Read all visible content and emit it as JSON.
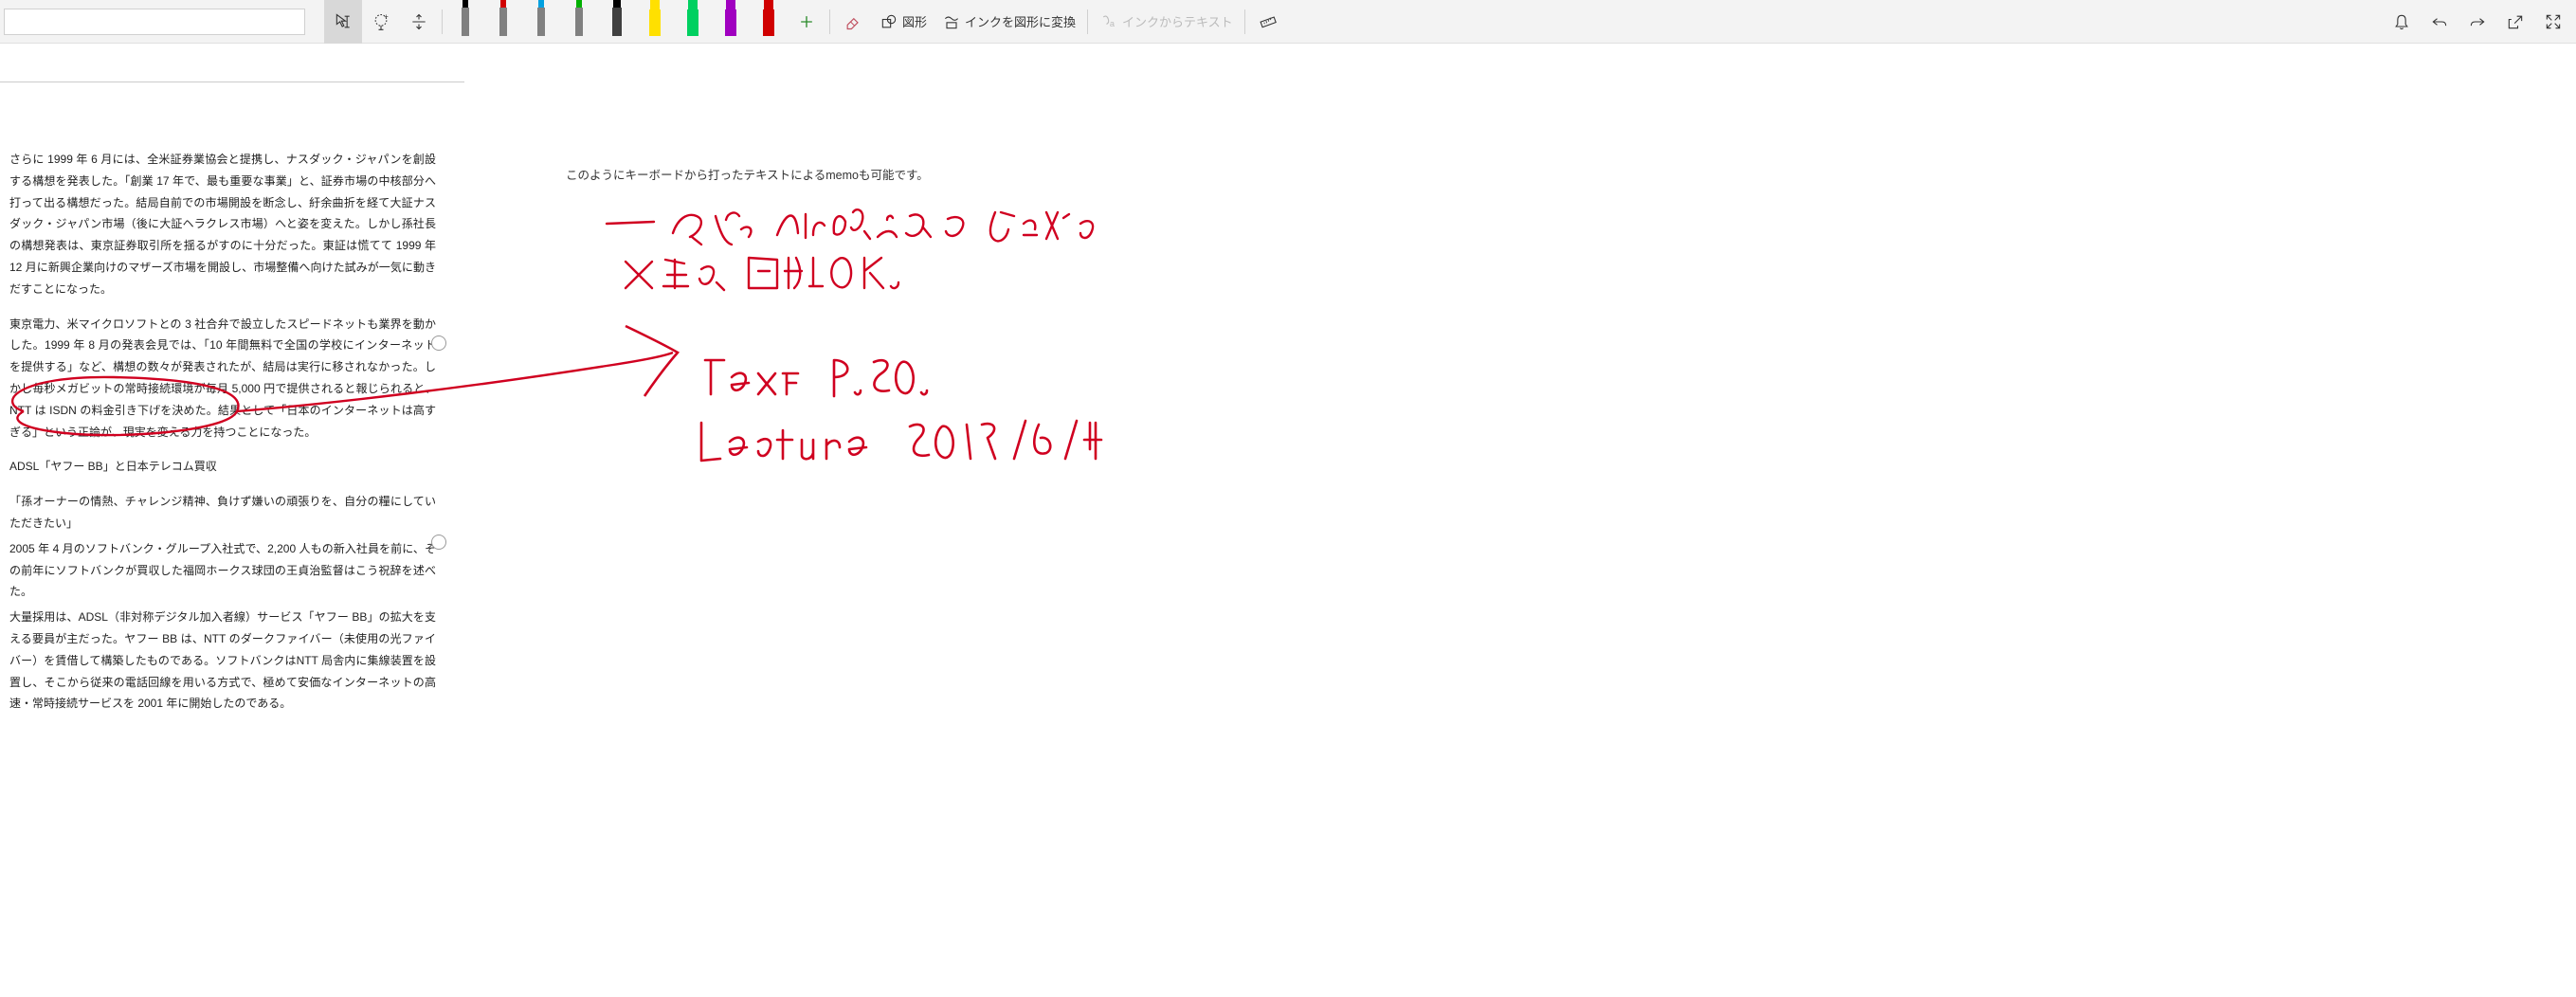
{
  "toolbar": {
    "search_placeholder": "",
    "shape_label": "図形",
    "ink_to_shape_label": "インクを図形に変換",
    "ink_to_text_label": "インクからテキスト",
    "pens": [
      {
        "tip": "#000000",
        "body": "#808080"
      },
      {
        "tip": "#d00000",
        "body": "#808080"
      },
      {
        "tip": "#00a0e0",
        "body": "#808080"
      },
      {
        "tip": "#00b000",
        "body": "#808080"
      },
      {
        "tip": "#000000",
        "body": "#404040"
      },
      {
        "tip": "#ffe000",
        "body": "#ffe000",
        "hl": true
      },
      {
        "tip": "#00d060",
        "body": "#00d060",
        "hl": true
      },
      {
        "tip": "#a000c0",
        "body": "#a000c0",
        "hl": true
      },
      {
        "tip": "#d00000",
        "body": "#d00000",
        "hl": true
      }
    ]
  },
  "document": {
    "para1": "さらに 1999 年 6 月には、全米証券業協会と提携し、ナスダック・ジャパンを創設する構想を発表した。「創業 17 年で、最も重要な事業」と、証券市場の中核部分へ打って出る構想だった。結局自前での市場開設を断念し、紆余曲折を経て大証ナスダック・ジャパン市場（後に大証ヘラクレス市場）へと姿を変えた。しかし孫社長の構想発表は、東京証券取引所を揺るがすのに十分だった。東証は慌てて 1999 年 12 月に新興企業向けのマザーズ市場を開設し、市場整備へ向けた試みが一気に動きだすことになった。",
    "para2": "東京電力、米マイクロソフトとの 3 社合弁で設立したスピードネットも業界を動かした。1999 年 8 月の発表会見では、「10 年間無料で全国の学校にインターネットを提供する」など、構想の数々が発表されたが、結局は実行に移されなかった。しかし毎秒メガビットの常時接続環境が毎月 5,000 円で提供されると報じられると、NTT は ISDN の料金引き下げを決めた。結果として「日本のインターネットは高すぎる」という正論が、現実を変える力を持つことになった。",
    "heading": "ADSL「ヤフー BB」と日本テレコム買収",
    "para3": "「孫オーナーの情熱、チャレンジ精神、負けず嫌いの頑張りを、自分の糧にしていただきたい」",
    "para4": "2005 年 4 月のソフトバンク・グループ入社式で、2,200 人もの新入社員を前に、その前年にソフトバンクが買収した福岡ホークス球団の王貞治監督はこう祝辞を述べた。",
    "para5": "大量採用は、ADSL（非対称デジタル加入者線）サービス「ヤフー BB」の拡大を支える要員が主だった。ヤフー BB は、NTT のダークファイバー（未使用の光ファイバー）を賃借して構築したものである。ソフトバンクはNTT 局舎内に集線装置を設置し、そこから従来の電話回線を用いる方式で、極めて安価なインターネットの高速・常時接続サービスを 2001 年に開始したのである。"
  },
  "notes": {
    "typed": "このようにキーボードから打ったテキストによるmemoも可能です。"
  }
}
